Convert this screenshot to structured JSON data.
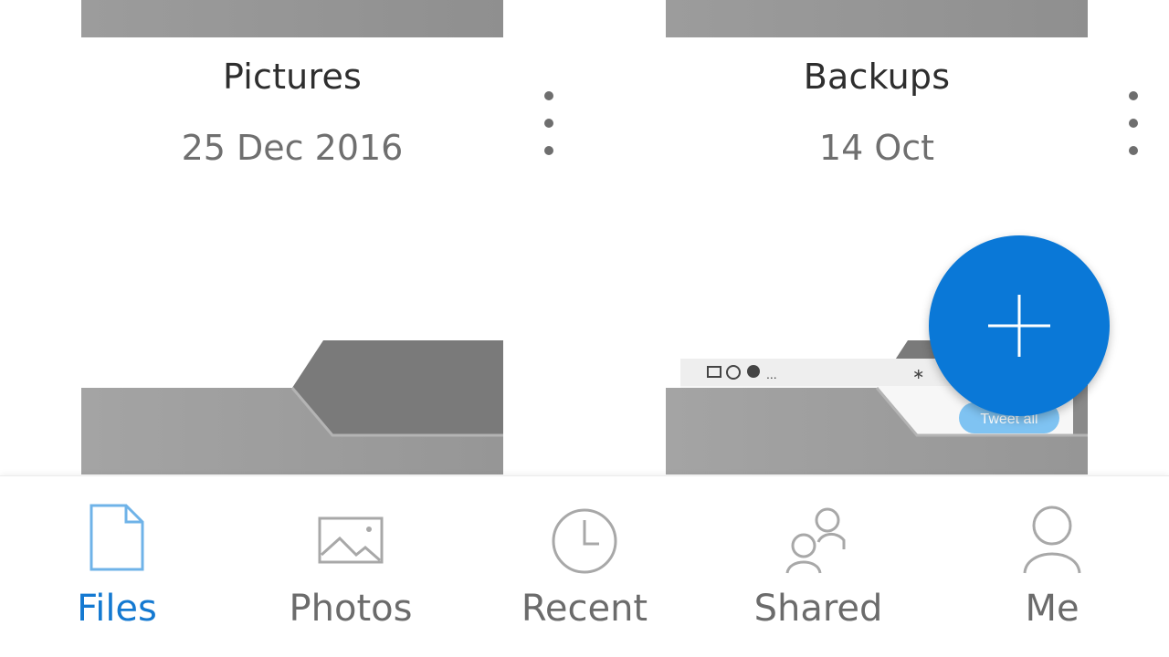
{
  "folders": [
    {
      "title": "Pictures",
      "date": "25 Dec 2016"
    },
    {
      "title": "Backups",
      "date": "14 Oct"
    }
  ],
  "thumbnail_snippet": {
    "button_text": "Tweet all",
    "status_text": "..."
  },
  "fab": {
    "icon": "plus-icon"
  },
  "bottom_nav": {
    "items": [
      {
        "label": "Files",
        "icon": "file-icon",
        "active": true
      },
      {
        "label": "Photos",
        "icon": "image-icon",
        "active": false
      },
      {
        "label": "Recent",
        "icon": "clock-icon",
        "active": false
      },
      {
        "label": "Shared",
        "icon": "people-icon",
        "active": false
      },
      {
        "label": "Me",
        "icon": "person-icon",
        "active": false
      }
    ]
  },
  "colors": {
    "accent": "#0a78d7",
    "active_label": "#1479d1",
    "inactive": "#6b6b6b",
    "folder_gray": "#9a9a9a"
  }
}
